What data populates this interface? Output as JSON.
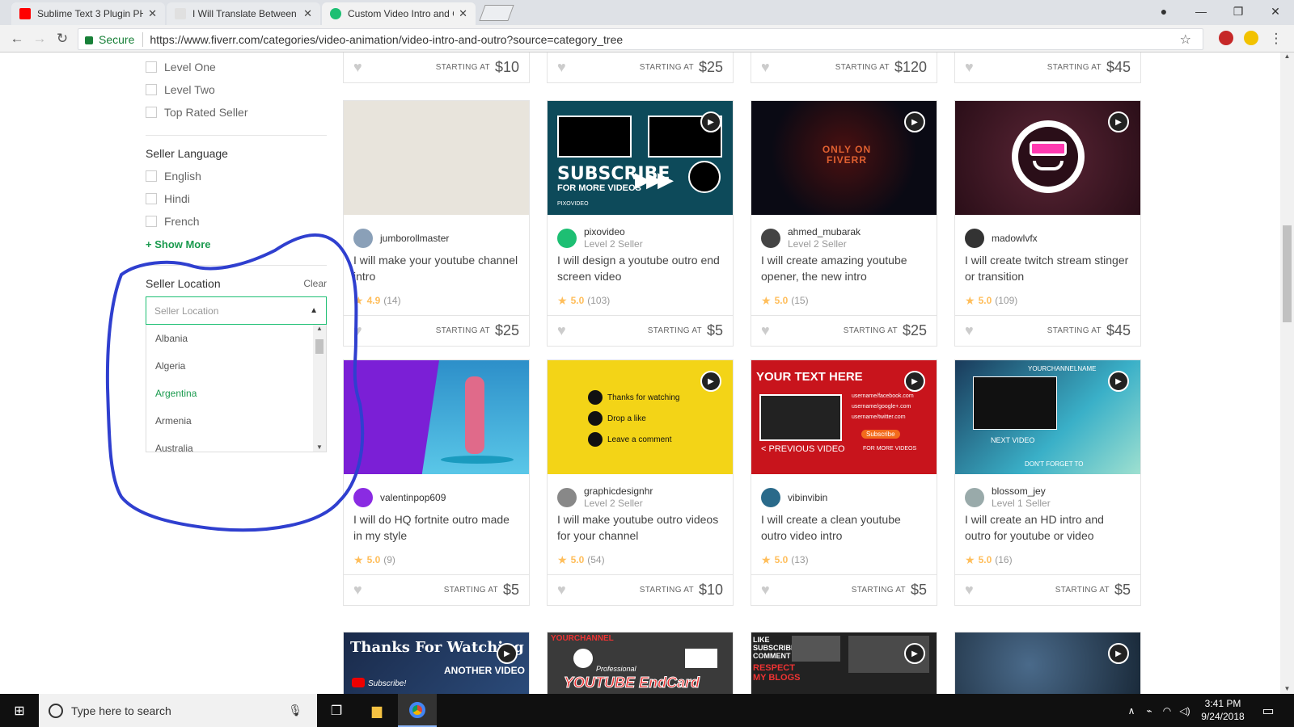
{
  "tabs": [
    {
      "title": "Sublime Text 3 Plugin PH",
      "color": "#ff0000"
    },
    {
      "title": "I Will Translate Between A",
      "color": "#1dbf73"
    },
    {
      "title": "Custom Video Intro and O",
      "color": "#1dbf73"
    }
  ],
  "address": {
    "secure": "Secure",
    "url": "https://www.fiverr.com/categories/video-animation/video-intro-and-outro?source=category_tree"
  },
  "sidebar": {
    "levels": [
      "Level One",
      "Level Two",
      "Top Rated Seller"
    ],
    "language_head": "Seller Language",
    "languages": [
      "English",
      "Hindi",
      "French"
    ],
    "show_more": "+ Show More",
    "location_head": "Seller Location",
    "clear": "Clear",
    "location_placeholder": "Seller Location",
    "countries": [
      "Albania",
      "Algeria",
      "Argentina",
      "Armenia",
      "Australia"
    ]
  },
  "starting_at": "STARTING AT",
  "top_prices": [
    "$10",
    "$25",
    "$120",
    "$45"
  ],
  "gigs": [
    {
      "seller": "jumborollmaster",
      "level": "",
      "title": "I will make your youtube channel intro",
      "rating": "4.9",
      "count": "(14)",
      "price": "$25"
    },
    {
      "seller": "pixovideo",
      "level": "Level 2 Seller",
      "title": "I will design a youtube outro end screen video",
      "rating": "5.0",
      "count": "(103)",
      "price": "$5"
    },
    {
      "seller": "ahmed_mubarak",
      "level": "Level 2 Seller",
      "title": "I will create amazing youtube opener, the new intro",
      "rating": "5.0",
      "count": "(15)",
      "price": "$25"
    },
    {
      "seller": "madowlvfx",
      "level": "",
      "title": "I will create twitch stream stinger or transition",
      "rating": "5.0",
      "count": "(109)",
      "price": "$45"
    },
    {
      "seller": "valentinpop609",
      "level": "",
      "title": "I will do HQ fortnite outro made in my style",
      "rating": "5.0",
      "count": "(9)",
      "price": "$5"
    },
    {
      "seller": "graphicdesignhr",
      "level": "Level 2 Seller",
      "title": "I will make youtube outro videos for your channel",
      "rating": "5.0",
      "count": "(54)",
      "price": "$10"
    },
    {
      "seller": "vibinvibin",
      "level": "",
      "title": "I will create a clean youtube outro video intro",
      "rating": "5.0",
      "count": "(13)",
      "price": "$5"
    },
    {
      "seller": "blossom_jey",
      "level": "Level 1 Seller",
      "title": "I will create an HD intro and outro for youtube or video",
      "rating": "5.0",
      "count": "(16)",
      "price": "$5"
    }
  ],
  "thumbs": {
    "t2": {
      "big": "SUBSCRIBE",
      "small": "FOR MORE VIDEOS",
      "brand": "PIXOVIDEO"
    },
    "t3": "ONLY ON FIVERR",
    "t6": [
      "Thanks for watching",
      "Drop a like",
      "Leave a comment"
    ],
    "t7": {
      "head": "YOUR TEXT HERE",
      "prev": "< PREVIOUS VIDEO",
      "sub": "Subscribe",
      "more": "FOR MORE VIDEOS",
      "links": [
        "username/facebook.com",
        "username/google+.com",
        "username/twitter.com"
      ]
    },
    "t8": {
      "top": "YOURCHANNELNAME",
      "next": "NEXT VIDEO",
      "dont": "DON'T FORGET TO"
    },
    "b1": {
      "a": "Thanks For Watching",
      "b": "ANOTHER VIDEO",
      "c": "Subscribe!"
    },
    "b2": {
      "a": "YOURCHANNEL",
      "b": "Professional",
      "c": "YOUTUBE EndCard"
    },
    "b3": {
      "a": "LIKE",
      "b": "SUBSCRIBE",
      "c": "COMMENT",
      "d": "RESPECT",
      "e": "MY BLOGS"
    }
  },
  "taskbar": {
    "search": "Type here to search",
    "time": "3:41 PM",
    "date": "9/24/2018"
  },
  "colors": {
    "accent": "#1dbf73",
    "annotation": "#2f3fcf"
  }
}
